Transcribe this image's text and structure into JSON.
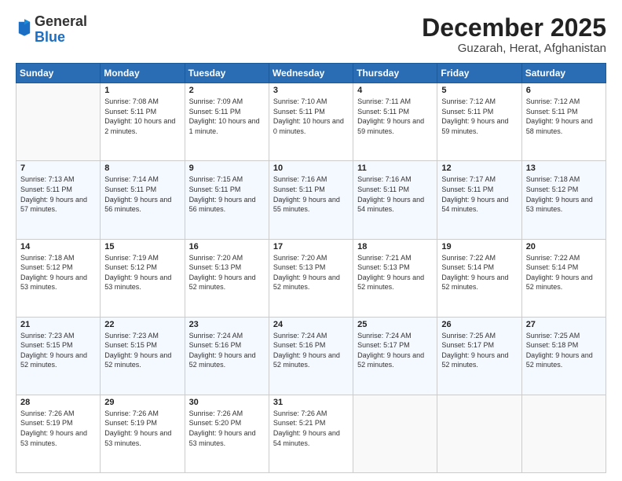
{
  "header": {
    "logo_line1": "General",
    "logo_line2": "Blue",
    "month": "December 2025",
    "location": "Guzarah, Herat, Afghanistan"
  },
  "weekdays": [
    "Sunday",
    "Monday",
    "Tuesday",
    "Wednesday",
    "Thursday",
    "Friday",
    "Saturday"
  ],
  "weeks": [
    [
      {
        "day": "",
        "sunrise": "",
        "sunset": "",
        "daylight": ""
      },
      {
        "day": "1",
        "sunrise": "Sunrise: 7:08 AM",
        "sunset": "Sunset: 5:11 PM",
        "daylight": "Daylight: 10 hours and 2 minutes."
      },
      {
        "day": "2",
        "sunrise": "Sunrise: 7:09 AM",
        "sunset": "Sunset: 5:11 PM",
        "daylight": "Daylight: 10 hours and 1 minute."
      },
      {
        "day": "3",
        "sunrise": "Sunrise: 7:10 AM",
        "sunset": "Sunset: 5:11 PM",
        "daylight": "Daylight: 10 hours and 0 minutes."
      },
      {
        "day": "4",
        "sunrise": "Sunrise: 7:11 AM",
        "sunset": "Sunset: 5:11 PM",
        "daylight": "Daylight: 9 hours and 59 minutes."
      },
      {
        "day": "5",
        "sunrise": "Sunrise: 7:12 AM",
        "sunset": "Sunset: 5:11 PM",
        "daylight": "Daylight: 9 hours and 59 minutes."
      },
      {
        "day": "6",
        "sunrise": "Sunrise: 7:12 AM",
        "sunset": "Sunset: 5:11 PM",
        "daylight": "Daylight: 9 hours and 58 minutes."
      }
    ],
    [
      {
        "day": "7",
        "sunrise": "Sunrise: 7:13 AM",
        "sunset": "Sunset: 5:11 PM",
        "daylight": "Daylight: 9 hours and 57 minutes."
      },
      {
        "day": "8",
        "sunrise": "Sunrise: 7:14 AM",
        "sunset": "Sunset: 5:11 PM",
        "daylight": "Daylight: 9 hours and 56 minutes."
      },
      {
        "day": "9",
        "sunrise": "Sunrise: 7:15 AM",
        "sunset": "Sunset: 5:11 PM",
        "daylight": "Daylight: 9 hours and 56 minutes."
      },
      {
        "day": "10",
        "sunrise": "Sunrise: 7:16 AM",
        "sunset": "Sunset: 5:11 PM",
        "daylight": "Daylight: 9 hours and 55 minutes."
      },
      {
        "day": "11",
        "sunrise": "Sunrise: 7:16 AM",
        "sunset": "Sunset: 5:11 PM",
        "daylight": "Daylight: 9 hours and 54 minutes."
      },
      {
        "day": "12",
        "sunrise": "Sunrise: 7:17 AM",
        "sunset": "Sunset: 5:11 PM",
        "daylight": "Daylight: 9 hours and 54 minutes."
      },
      {
        "day": "13",
        "sunrise": "Sunrise: 7:18 AM",
        "sunset": "Sunset: 5:12 PM",
        "daylight": "Daylight: 9 hours and 53 minutes."
      }
    ],
    [
      {
        "day": "14",
        "sunrise": "Sunrise: 7:18 AM",
        "sunset": "Sunset: 5:12 PM",
        "daylight": "Daylight: 9 hours and 53 minutes."
      },
      {
        "day": "15",
        "sunrise": "Sunrise: 7:19 AM",
        "sunset": "Sunset: 5:12 PM",
        "daylight": "Daylight: 9 hours and 53 minutes."
      },
      {
        "day": "16",
        "sunrise": "Sunrise: 7:20 AM",
        "sunset": "Sunset: 5:13 PM",
        "daylight": "Daylight: 9 hours and 52 minutes."
      },
      {
        "day": "17",
        "sunrise": "Sunrise: 7:20 AM",
        "sunset": "Sunset: 5:13 PM",
        "daylight": "Daylight: 9 hours and 52 minutes."
      },
      {
        "day": "18",
        "sunrise": "Sunrise: 7:21 AM",
        "sunset": "Sunset: 5:13 PM",
        "daylight": "Daylight: 9 hours and 52 minutes."
      },
      {
        "day": "19",
        "sunrise": "Sunrise: 7:22 AM",
        "sunset": "Sunset: 5:14 PM",
        "daylight": "Daylight: 9 hours and 52 minutes."
      },
      {
        "day": "20",
        "sunrise": "Sunrise: 7:22 AM",
        "sunset": "Sunset: 5:14 PM",
        "daylight": "Daylight: 9 hours and 52 minutes."
      }
    ],
    [
      {
        "day": "21",
        "sunrise": "Sunrise: 7:23 AM",
        "sunset": "Sunset: 5:15 PM",
        "daylight": "Daylight: 9 hours and 52 minutes."
      },
      {
        "day": "22",
        "sunrise": "Sunrise: 7:23 AM",
        "sunset": "Sunset: 5:15 PM",
        "daylight": "Daylight: 9 hours and 52 minutes."
      },
      {
        "day": "23",
        "sunrise": "Sunrise: 7:24 AM",
        "sunset": "Sunset: 5:16 PM",
        "daylight": "Daylight: 9 hours and 52 minutes."
      },
      {
        "day": "24",
        "sunrise": "Sunrise: 7:24 AM",
        "sunset": "Sunset: 5:16 PM",
        "daylight": "Daylight: 9 hours and 52 minutes."
      },
      {
        "day": "25",
        "sunrise": "Sunrise: 7:24 AM",
        "sunset": "Sunset: 5:17 PM",
        "daylight": "Daylight: 9 hours and 52 minutes."
      },
      {
        "day": "26",
        "sunrise": "Sunrise: 7:25 AM",
        "sunset": "Sunset: 5:17 PM",
        "daylight": "Daylight: 9 hours and 52 minutes."
      },
      {
        "day": "27",
        "sunrise": "Sunrise: 7:25 AM",
        "sunset": "Sunset: 5:18 PM",
        "daylight": "Daylight: 9 hours and 52 minutes."
      }
    ],
    [
      {
        "day": "28",
        "sunrise": "Sunrise: 7:26 AM",
        "sunset": "Sunset: 5:19 PM",
        "daylight": "Daylight: 9 hours and 53 minutes."
      },
      {
        "day": "29",
        "sunrise": "Sunrise: 7:26 AM",
        "sunset": "Sunset: 5:19 PM",
        "daylight": "Daylight: 9 hours and 53 minutes."
      },
      {
        "day": "30",
        "sunrise": "Sunrise: 7:26 AM",
        "sunset": "Sunset: 5:20 PM",
        "daylight": "Daylight: 9 hours and 53 minutes."
      },
      {
        "day": "31",
        "sunrise": "Sunrise: 7:26 AM",
        "sunset": "Sunset: 5:21 PM",
        "daylight": "Daylight: 9 hours and 54 minutes."
      },
      {
        "day": "",
        "sunrise": "",
        "sunset": "",
        "daylight": ""
      },
      {
        "day": "",
        "sunrise": "",
        "sunset": "",
        "daylight": ""
      },
      {
        "day": "",
        "sunrise": "",
        "sunset": "",
        "daylight": ""
      }
    ]
  ]
}
